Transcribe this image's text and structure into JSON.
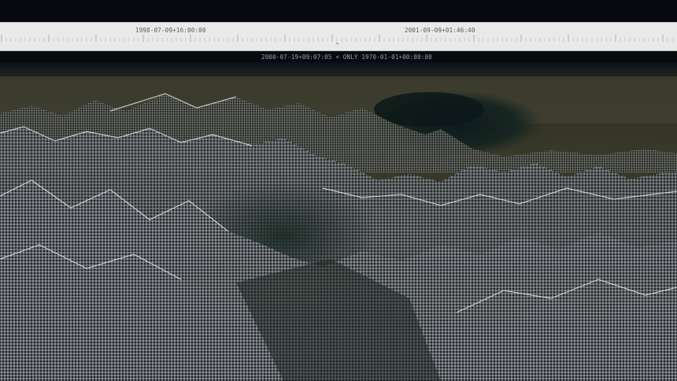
{
  "timeline": {
    "start_label": "1998-07-09+16:00:00",
    "end_label": "2001-09-09+01:46:40",
    "cursor_icon": "caret-up"
  },
  "status": {
    "current_time": "2000-07-19+09:07:05",
    "prev_symbol": "<",
    "mode": "ONLY",
    "epoch_time": "1970-01-01+00:00:00"
  },
  "view": {
    "type": "3d-wireframe-terrain"
  }
}
